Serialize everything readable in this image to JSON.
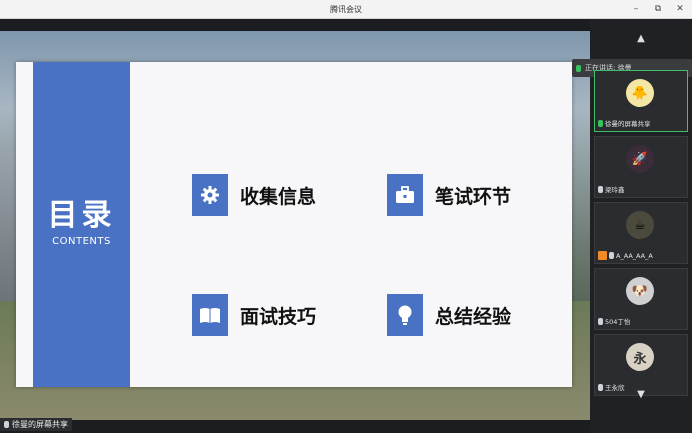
{
  "window": {
    "title": "腾讯会议",
    "minimize": "–",
    "restore": "⧉",
    "close": "✕"
  },
  "slide": {
    "title": "目录",
    "subtitle": "CONTENTS",
    "items": [
      {
        "label": "收集信息",
        "icon": "gear-icon"
      },
      {
        "label": "笔试环节",
        "icon": "briefcase-icon"
      },
      {
        "label": "面试技巧",
        "icon": "book-icon"
      },
      {
        "label": "总结经验",
        "icon": "lightbulb-icon"
      }
    ]
  },
  "share": {
    "label": "徐曼的屏幕共享"
  },
  "panel": {
    "scroll_up": "▲",
    "scroll_down": "▼",
    "speaking": "正在讲话: 徐曼",
    "participants": [
      {
        "name": "徐曼的屏幕共享",
        "avatar": "🐥"
      },
      {
        "name": "梁玲鑫",
        "avatar": "🚀"
      },
      {
        "name": "A_AA_AA_A",
        "avatar": "☕"
      },
      {
        "name": "504丁怡",
        "avatar": "🐶"
      },
      {
        "name": "王永欣",
        "avatar": "永"
      }
    ]
  }
}
